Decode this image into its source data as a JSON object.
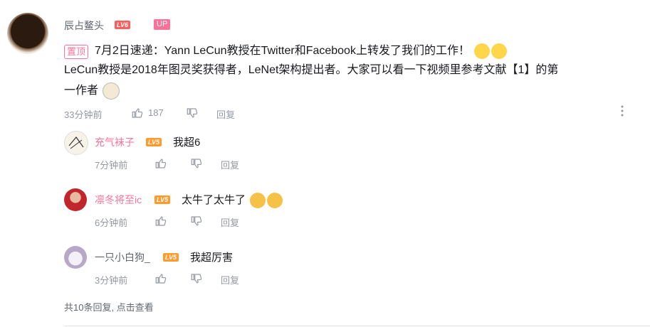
{
  "main_comment": {
    "username": "辰占鳌头",
    "level": "LV6",
    "up_label": "UP",
    "pin_label": "置顶",
    "line1": "7月2日速递：Yann LeCun教授在Twitter和Facebook上转发了我们的工作！",
    "line2": "LeCun教授是2018年图灵奖获得者，LeNet架构提出者。大家可以看一下视频里参考文献【1】的第",
    "line3": "一作者",
    "time": "33分钟前",
    "likes": "187",
    "reply_label": "回复"
  },
  "replies": [
    {
      "username": "充气袜子",
      "level": "LV5",
      "text": "我超6",
      "time": "7分钟前",
      "reply_label": "回复"
    },
    {
      "username": "凛冬将至ic",
      "level": "LV5",
      "text": "太牛了太牛了",
      "time": "6分钟前",
      "reply_label": "回复"
    },
    {
      "username": "一只小白狗_",
      "level": "LV5",
      "text": "我超厉害",
      "time": "3分钟前",
      "reply_label": "回复"
    }
  ],
  "more_replies": "共10条回复, 点击查看",
  "colors": {
    "pink": "#fb7299",
    "lv6": "#ff5e5e",
    "lv5": "#ff9a2e",
    "grey": "#9499a0"
  }
}
